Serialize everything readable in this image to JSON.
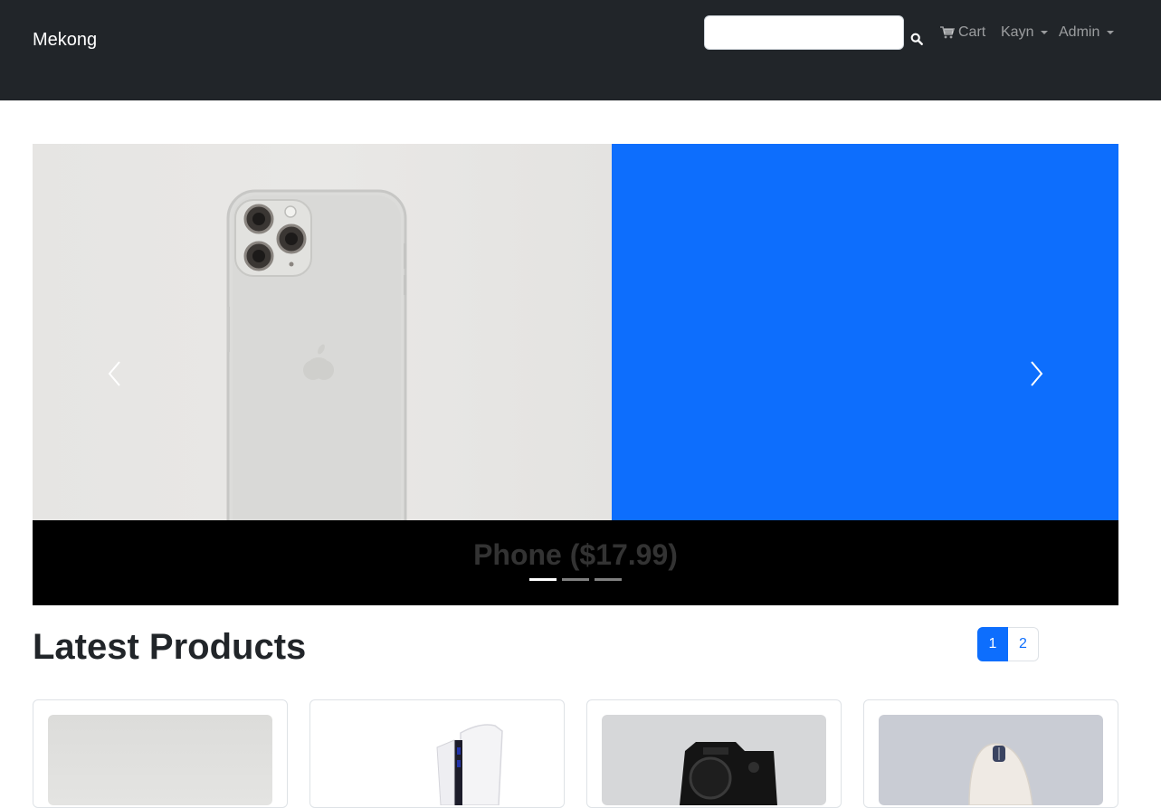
{
  "navbar": {
    "brand": "Mekong",
    "search": {
      "value": "",
      "placeholder": ""
    },
    "cart_label": "Cart",
    "user_menu_label": "Kayn",
    "admin_menu_label": "Admin"
  },
  "carousel": {
    "caption": "Phone ($17.99)",
    "indicators": 3,
    "active_indicator": 0
  },
  "products_section": {
    "title": "Latest Products",
    "pages": [
      "1",
      "2"
    ],
    "active_page": "1",
    "cards": [
      {
        "image": "silver-product-photo"
      },
      {
        "image": "game-console-photo"
      },
      {
        "image": "camera-photo"
      },
      {
        "image": "mouse-photo"
      }
    ]
  },
  "colors": {
    "navbar_bg": "#212529",
    "accent": "#0d6efd",
    "carousel_bg": "#000000"
  }
}
